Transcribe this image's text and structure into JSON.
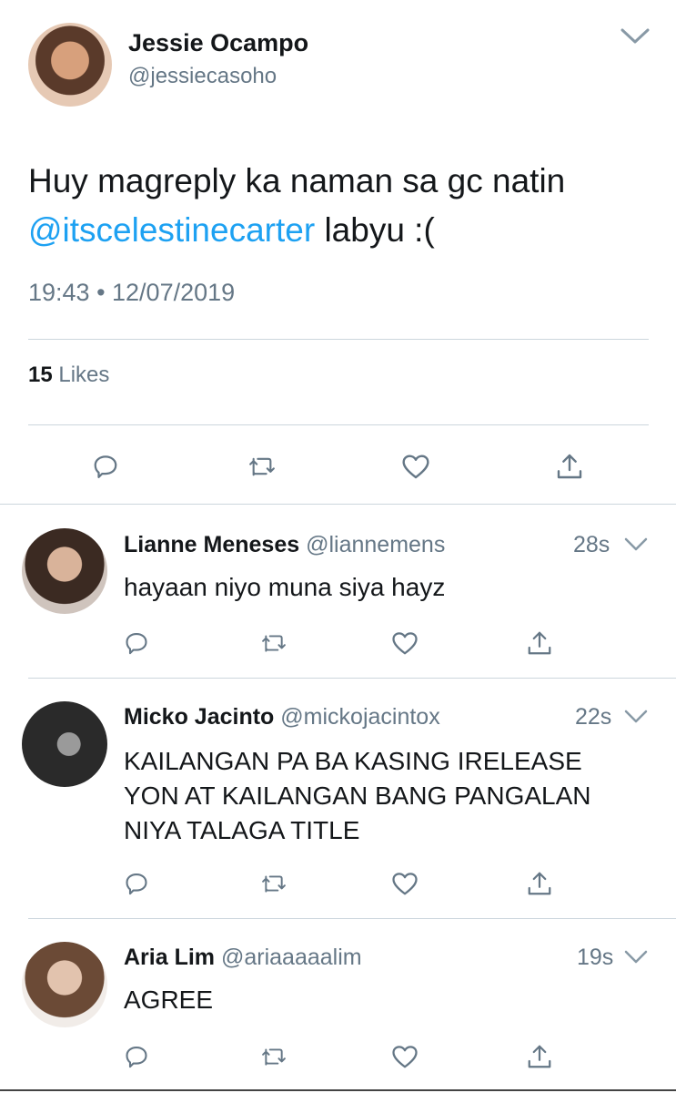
{
  "main_tweet": {
    "author_name": "Jessie Ocampo",
    "author_handle": "@jessiecasoho",
    "text_before": "Huy magreply ka naman sa gc natin",
    "mention": "@itscelestinecarter",
    "text_after": " labyu :(",
    "timestamp": "19:43 • 12/07/2019",
    "likes_count": "15",
    "likes_label": "Likes"
  },
  "replies": [
    {
      "author_name": "Lianne Meneses",
      "author_handle": "@liannemens",
      "time": "28s",
      "text_lines": [
        "hayaan niyo muna siya hayz"
      ]
    },
    {
      "author_name": "Micko Jacinto",
      "author_handle": "@mickojacintox",
      "time": "22s",
      "text_lines": [
        "KAILANGAN PA BA KASING IRELEASE",
        "YON AT KAILANGAN BANG PANGALAN",
        "NIYA TALAGA TITLE"
      ]
    },
    {
      "author_name": "Aria Lim",
      "author_handle": "@ariaaaaalim",
      "time": "19s",
      "text_lines": [
        "AGREE"
      ]
    }
  ],
  "icons": [
    "reply-icon",
    "retweet-icon",
    "like-icon",
    "share-icon",
    "chevron-down-icon"
  ],
  "colors": {
    "link": "#1da1f2",
    "muted": "#657786",
    "divider": "#ccd6dd",
    "icon": "#657786"
  }
}
